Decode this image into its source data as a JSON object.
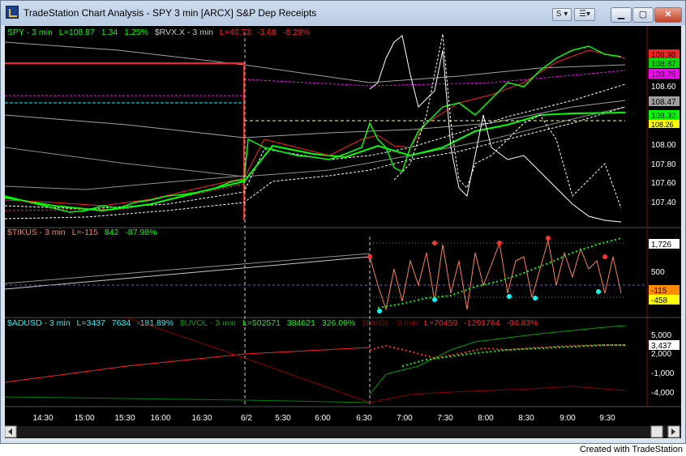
{
  "window": {
    "title": "TradeStation Chart Analysis - SPY 3 min [ARCX] S&P Dep Receipts",
    "s_button": "S",
    "cmd_button": "S"
  },
  "pane1": {
    "legend": [
      {
        "text": "SPY - 3 min",
        "color": "#00ff00"
      },
      {
        "text": "L=108.87",
        "color": "#00ff00"
      },
      {
        "text": "1.34",
        "color": "#00ff00"
      },
      {
        "text": "1.25%",
        "color": "#00ff00"
      },
      {
        "text": "$RVX.X - 3 min",
        "color": "#c8c8c8"
      },
      {
        "text": "L=40.73",
        "color": "#ff2020"
      },
      {
        "text": "-3.68",
        "color": "#ff2020"
      },
      {
        "text": "-8.29%",
        "color": "#ff2020"
      }
    ],
    "price_labels": [
      "108.60",
      "108.00",
      "107.80",
      "107.60",
      "107.40"
    ],
    "flags": [
      {
        "text": "108.98",
        "bg": "#ff2020",
        "fg": "#000000"
      },
      {
        "text": "108.87",
        "bg": "#00dd00",
        "fg": "#000000"
      },
      {
        "text": "108.76",
        "bg": "#ff00ff",
        "fg": "#000000"
      },
      {
        "text": "108.47",
        "bg": "#a0a0a0",
        "fg": "#000000"
      },
      {
        "text": "108.32",
        "bg": "#00ff00",
        "fg": "#000000"
      },
      {
        "text": "108.26",
        "bg": "#ffff00",
        "fg": "#000000"
      }
    ]
  },
  "pane2": {
    "legend": [
      {
        "text": "$TIKUS - 3 min",
        "color": "#ff7f50"
      },
      {
        "text": "L=-115",
        "color": "#ff7f50"
      },
      {
        "text": "842",
        "color": "#00ff00"
      },
      {
        "text": "-87.98%",
        "color": "#00ff00"
      }
    ],
    "scale_labels": [
      "500"
    ],
    "flags": [
      {
        "text": "1,726",
        "bg": "#ffffff",
        "fg": "#000000"
      },
      {
        "text": "-115",
        "bg": "#ff8c00",
        "fg": "#000000"
      },
      {
        "text": "-458",
        "bg": "#ffff00",
        "fg": "#000000"
      }
    ]
  },
  "pane3": {
    "legend": [
      {
        "text": "$ADUSD - 3 min",
        "color": "#00ffff"
      },
      {
        "text": "L=3437",
        "color": "#00ffff"
      },
      {
        "text": "7634",
        "color": "#00ffff"
      },
      {
        "text": "-181.89%",
        "color": "#00ffff"
      },
      {
        "text": "$UVOL - 3 min",
        "color": "#00a000"
      },
      {
        "text": "L=502571",
        "color": "#00ff00"
      },
      {
        "text": "384621",
        "color": "#00ff00"
      },
      {
        "text": "326.09%",
        "color": "#00ff00"
      },
      {
        "text": "$DVOL - 3 min",
        "color": "#8b0000"
      },
      {
        "text": "L=70459",
        "color": "#ff2020"
      },
      {
        "text": "-1291764",
        "color": "#ff2020"
      },
      {
        "text": "-94.83%",
        "color": "#ff2020"
      }
    ],
    "scale_labels": [
      "5,000",
      "2,000",
      "-1,000",
      "-4,000"
    ],
    "flags": [
      {
        "text": "3,437",
        "bg": "#ffffff",
        "fg": "#000000"
      }
    ]
  },
  "time_axis": [
    "14:30",
    "15:00",
    "15:30",
    "16:00",
    "16:30",
    "6/2",
    "5:30",
    "6:00",
    "6:30",
    "7:00",
    "7:30",
    "8:00",
    "8:30",
    "9:00",
    "9:30"
  ],
  "status": {
    "created": "Created with TradeStation"
  }
}
